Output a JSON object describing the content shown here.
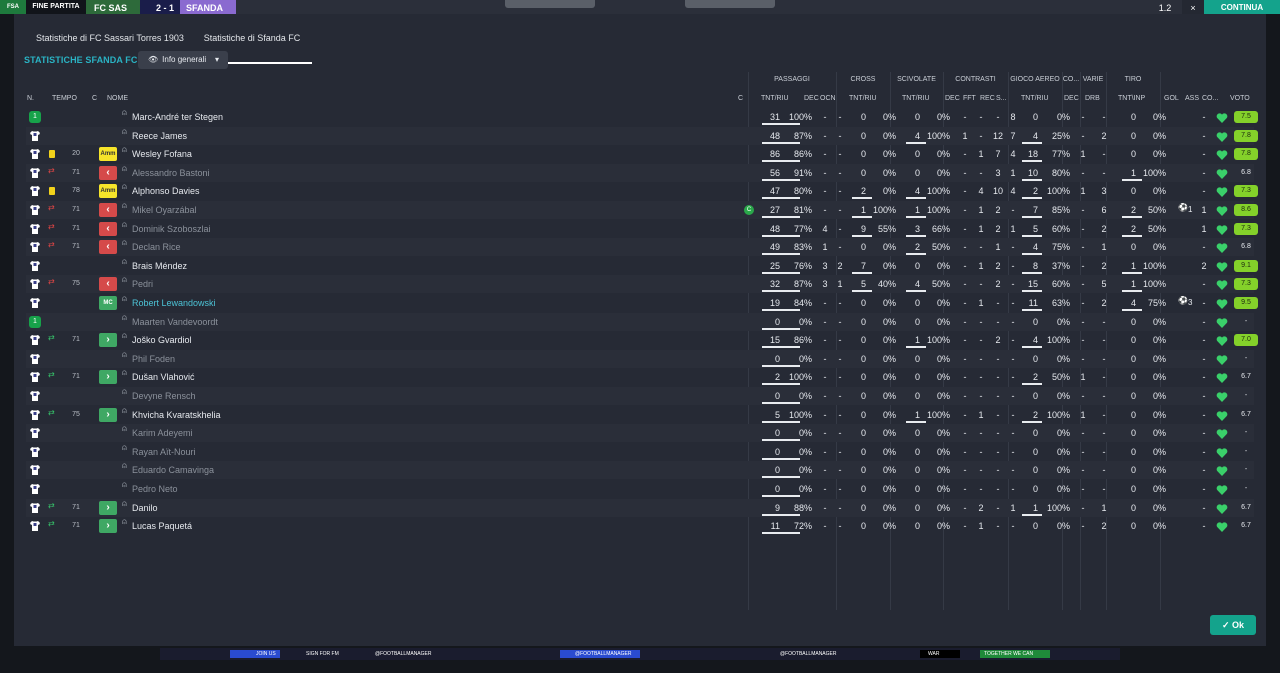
{
  "topbar": {
    "competition_badge": "FSA",
    "status": "FINE PARTITA",
    "home_short": "FC SAS",
    "score": "2 - 1",
    "away_short": "SFANDA",
    "speed": "1.2",
    "close": "×",
    "continue": "CONTINUA"
  },
  "tabs": [
    "Statistiche di FC Sassari Torres 1903",
    "Statistiche di Sfanda FC"
  ],
  "title": "STATISTICHE SFANDA FC",
  "view_dropdown": "Info generali",
  "groups": [
    "PASSAGGI",
    "CROSS",
    "SCIVOLATE",
    "CONTRASTI",
    "GIOCO AEREO",
    "CO...",
    "VARIE",
    "TIRO"
  ],
  "columns": {
    "n": "N.",
    "tempo": "TEMPO",
    "c": "C",
    "nome": "NOME",
    "c2": "C",
    "pass_tnt": "TNT/RIU",
    "pass_dec": "DEC",
    "pass_ocn": "OCN",
    "cross_tnt": "TNT/RIU",
    "sciv_tnt": "TNT/RIU",
    "contr_dec": "DEC",
    "contr_fft": "FFT",
    "contr_rec": "REC",
    "contr_s": "S...",
    "aereo_tnt": "TNT/RIU",
    "co_dec": "DEC",
    "varie_drb": "DRB",
    "tiro_tnt": "TNT\\INP",
    "gol": "GOL",
    "ass": "ASS",
    "co": "CO...",
    "voto": "VOTO"
  },
  "players": [
    {
      "shirt": "gk",
      "min": "",
      "status": "",
      "pos": "",
      "name": "Marc-André ter Stegen",
      "dim": false,
      "pass": [
        "31",
        "100%"
      ],
      "dec": "-",
      "ocn": "-",
      "cross": [
        "0",
        "0%"
      ],
      "sciv": [
        "0",
        "0%"
      ],
      "cdec": "-",
      "fft": "-",
      "rec": "-",
      "s": "8",
      "air": [
        "0",
        "0%"
      ],
      "codec": "-",
      "drb": "-",
      "tiro": [
        "0",
        "0%"
      ],
      "gol": "",
      "ass": "-",
      "voto": "7.5",
      "mom": ""
    },
    {
      "shirt": "w",
      "min": "",
      "status": "",
      "pos": "",
      "name": "Reece James",
      "dim": false,
      "pass": [
        "48",
        "87%"
      ],
      "dec": "-",
      "ocn": "-",
      "cross": [
        "0",
        "0%"
      ],
      "sciv": [
        "4",
        "100%"
      ],
      "cdec": "1",
      "fft": "-",
      "rec": "12",
      "s": "7",
      "air": [
        "4",
        "25%"
      ],
      "codec": "-",
      "drb": "2",
      "tiro": [
        "0",
        "0%"
      ],
      "gol": "",
      "ass": "-",
      "voto": "7.8",
      "mom": ""
    },
    {
      "shirt": "w",
      "min": "20",
      "status": "yellow",
      "pos": "Amm",
      "name": "Wesley Fofana",
      "dim": false,
      "pass": [
        "86",
        "86%"
      ],
      "dec": "-",
      "ocn": "-",
      "cross": [
        "0",
        "0%"
      ],
      "sciv": [
        "0",
        "0%"
      ],
      "cdec": "-",
      "fft": "1",
      "rec": "7",
      "s": "4",
      "air": [
        "18",
        "77%"
      ],
      "codec": "1",
      "drb": "-",
      "tiro": [
        "0",
        "0%"
      ],
      "gol": "",
      "ass": "-",
      "voto": "7.8",
      "mom": ""
    },
    {
      "shirt": "w",
      "min": "71",
      "status": "subout",
      "pos": "out",
      "name": "Alessandro Bastoni",
      "dim": true,
      "pass": [
        "56",
        "91%"
      ],
      "dec": "-",
      "ocn": "-",
      "cross": [
        "0",
        "0%"
      ],
      "sciv": [
        "0",
        "0%"
      ],
      "cdec": "-",
      "fft": "-",
      "rec": "3",
      "s": "1",
      "air": [
        "10",
        "80%"
      ],
      "codec": "-",
      "drb": "-",
      "tiro": [
        "1",
        "100%"
      ],
      "gol": "",
      "ass": "-",
      "voto": "6.8",
      "mom": ""
    },
    {
      "shirt": "w",
      "min": "78",
      "status": "yellow",
      "pos": "Amm",
      "name": "Alphonso Davies",
      "dim": false,
      "pass": [
        "47",
        "80%"
      ],
      "dec": "-",
      "ocn": "-",
      "cross": [
        "2",
        "0%"
      ],
      "sciv": [
        "4",
        "100%"
      ],
      "cdec": "-",
      "fft": "4",
      "rec": "10",
      "s": "4",
      "air": [
        "2",
        "100%"
      ],
      "codec": "1",
      "drb": "3",
      "tiro": [
        "0",
        "0%"
      ],
      "gol": "",
      "ass": "-",
      "voto": "7.3",
      "mom": ""
    },
    {
      "shirt": "w",
      "min": "71",
      "status": "subout",
      "pos": "out",
      "name": "Mikel Oyarzábal",
      "dim": true,
      "pass": [
        "27",
        "81%"
      ],
      "dec": "-",
      "ocn": "-",
      "cross": [
        "1",
        "100%"
      ],
      "sciv": [
        "1",
        "100%"
      ],
      "cdec": "-",
      "fft": "1",
      "rec": "2",
      "s": "-",
      "air": [
        "7",
        "85%"
      ],
      "codec": "-",
      "drb": "6",
      "tiro": [
        "2",
        "50%"
      ],
      "gol": "1",
      "ass": "1",
      "voto": "8.6",
      "mom": "C"
    },
    {
      "shirt": "w",
      "min": "71",
      "status": "subout",
      "pos": "out",
      "name": "Dominik Szoboszlai",
      "dim": true,
      "pass": [
        "48",
        "77%"
      ],
      "dec": "4",
      "ocn": "-",
      "cross": [
        "9",
        "55%"
      ],
      "sciv": [
        "3",
        "66%"
      ],
      "cdec": "-",
      "fft": "1",
      "rec": "2",
      "s": "1",
      "air": [
        "5",
        "60%"
      ],
      "codec": "-",
      "drb": "2",
      "tiro": [
        "2",
        "50%"
      ],
      "gol": "",
      "ass": "1",
      "voto": "7.3",
      "mom": ""
    },
    {
      "shirt": "w",
      "min": "71",
      "status": "subout",
      "pos": "out",
      "name": "Declan Rice",
      "dim": true,
      "pass": [
        "49",
        "83%"
      ],
      "dec": "1",
      "ocn": "-",
      "cross": [
        "0",
        "0%"
      ],
      "sciv": [
        "2",
        "50%"
      ],
      "cdec": "-",
      "fft": "-",
      "rec": "1",
      "s": "-",
      "air": [
        "4",
        "75%"
      ],
      "codec": "-",
      "drb": "1",
      "tiro": [
        "0",
        "0%"
      ],
      "gol": "",
      "ass": "-",
      "voto": "6.8",
      "mom": ""
    },
    {
      "shirt": "w",
      "min": "",
      "status": "",
      "pos": "",
      "name": "Brais Méndez",
      "dim": false,
      "pass": [
        "25",
        "76%"
      ],
      "dec": "3",
      "ocn": "2",
      "cross": [
        "7",
        "0%"
      ],
      "sciv": [
        "0",
        "0%"
      ],
      "cdec": "-",
      "fft": "1",
      "rec": "2",
      "s": "-",
      "air": [
        "8",
        "37%"
      ],
      "codec": "-",
      "drb": "2",
      "tiro": [
        "1",
        "100%"
      ],
      "gol": "",
      "ass": "2",
      "voto": "9.1",
      "mom": ""
    },
    {
      "shirt": "w",
      "min": "75",
      "status": "subout",
      "pos": "out",
      "name": "Pedri",
      "dim": true,
      "pass": [
        "32",
        "87%"
      ],
      "dec": "3",
      "ocn": "1",
      "cross": [
        "5",
        "40%"
      ],
      "sciv": [
        "4",
        "50%"
      ],
      "cdec": "-",
      "fft": "-",
      "rec": "2",
      "s": "-",
      "air": [
        "15",
        "60%"
      ],
      "codec": "-",
      "drb": "5",
      "tiro": [
        "1",
        "100%"
      ],
      "gol": "",
      "ass": "-",
      "voto": "7.3",
      "mom": ""
    },
    {
      "shirt": "w",
      "min": "",
      "status": "",
      "pos": "MC",
      "name": "Robert Lewandowski",
      "dim": false,
      "hl": true,
      "pass": [
        "19",
        "84%"
      ],
      "dec": "-",
      "ocn": "-",
      "cross": [
        "0",
        "0%"
      ],
      "sciv": [
        "0",
        "0%"
      ],
      "cdec": "-",
      "fft": "1",
      "rec": "-",
      "s": "-",
      "air": [
        "11",
        "63%"
      ],
      "codec": "-",
      "drb": "2",
      "tiro": [
        "4",
        "75%"
      ],
      "gol": "3",
      "ass": "-",
      "voto": "9.5",
      "mom": ""
    },
    {
      "shirt": "gk",
      "min": "",
      "status": "",
      "pos": "",
      "name": "Maarten Vandevoordt",
      "dim": true,
      "pass": [
        "0",
        "0%"
      ],
      "dec": "-",
      "ocn": "-",
      "cross": [
        "0",
        "0%"
      ],
      "sciv": [
        "0",
        "0%"
      ],
      "cdec": "-",
      "fft": "-",
      "rec": "-",
      "s": "-",
      "air": [
        "0",
        "0%"
      ],
      "codec": "-",
      "drb": "-",
      "tiro": [
        "0",
        "0%"
      ],
      "gol": "",
      "ass": "-",
      "voto": "-",
      "mom": ""
    },
    {
      "shirt": "w",
      "min": "71",
      "status": "subin",
      "pos": "in",
      "name": "Joško Gvardiol",
      "dim": false,
      "pass": [
        "15",
        "86%"
      ],
      "dec": "-",
      "ocn": "-",
      "cross": [
        "0",
        "0%"
      ],
      "sciv": [
        "1",
        "100%"
      ],
      "cdec": "-",
      "fft": "-",
      "rec": "2",
      "s": "-",
      "air": [
        "4",
        "100%"
      ],
      "codec": "-",
      "drb": "-",
      "tiro": [
        "0",
        "0%"
      ],
      "gol": "",
      "ass": "-",
      "voto": "7.0",
      "mom": ""
    },
    {
      "shirt": "w",
      "min": "",
      "status": "",
      "pos": "",
      "name": "Phil Foden",
      "dim": true,
      "pass": [
        "0",
        "0%"
      ],
      "dec": "-",
      "ocn": "-",
      "cross": [
        "0",
        "0%"
      ],
      "sciv": [
        "0",
        "0%"
      ],
      "cdec": "-",
      "fft": "-",
      "rec": "-",
      "s": "-",
      "air": [
        "0",
        "0%"
      ],
      "codec": "-",
      "drb": "-",
      "tiro": [
        "0",
        "0%"
      ],
      "gol": "",
      "ass": "-",
      "voto": "-",
      "mom": ""
    },
    {
      "shirt": "w",
      "min": "71",
      "status": "subin",
      "pos": "in",
      "name": "Dušan Vlahović",
      "dim": false,
      "pass": [
        "2",
        "100%"
      ],
      "dec": "-",
      "ocn": "-",
      "cross": [
        "0",
        "0%"
      ],
      "sciv": [
        "0",
        "0%"
      ],
      "cdec": "-",
      "fft": "-",
      "rec": "-",
      "s": "-",
      "air": [
        "2",
        "50%"
      ],
      "codec": "1",
      "drb": "-",
      "tiro": [
        "0",
        "0%"
      ],
      "gol": "",
      "ass": "-",
      "voto": "6.7",
      "mom": ""
    },
    {
      "shirt": "w",
      "min": "",
      "status": "",
      "pos": "",
      "name": "Devyne Rensch",
      "dim": true,
      "pass": [
        "0",
        "0%"
      ],
      "dec": "-",
      "ocn": "-",
      "cross": [
        "0",
        "0%"
      ],
      "sciv": [
        "0",
        "0%"
      ],
      "cdec": "-",
      "fft": "-",
      "rec": "-",
      "s": "-",
      "air": [
        "0",
        "0%"
      ],
      "codec": "-",
      "drb": "-",
      "tiro": [
        "0",
        "0%"
      ],
      "gol": "",
      "ass": "-",
      "voto": "-",
      "mom": ""
    },
    {
      "shirt": "w",
      "min": "75",
      "status": "subin",
      "pos": "in",
      "name": "Khvicha Kvaratskhelia",
      "dim": false,
      "pass": [
        "5",
        "100%"
      ],
      "dec": "-",
      "ocn": "-",
      "cross": [
        "0",
        "0%"
      ],
      "sciv": [
        "1",
        "100%"
      ],
      "cdec": "-",
      "fft": "1",
      "rec": "-",
      "s": "-",
      "air": [
        "2",
        "100%"
      ],
      "codec": "1",
      "drb": "-",
      "tiro": [
        "0",
        "0%"
      ],
      "gol": "",
      "ass": "-",
      "voto": "6.7",
      "mom": ""
    },
    {
      "shirt": "w",
      "min": "",
      "status": "",
      "pos": "",
      "name": "Karim Adeyemi",
      "dim": true,
      "pass": [
        "0",
        "0%"
      ],
      "dec": "-",
      "ocn": "-",
      "cross": [
        "0",
        "0%"
      ],
      "sciv": [
        "0",
        "0%"
      ],
      "cdec": "-",
      "fft": "-",
      "rec": "-",
      "s": "-",
      "air": [
        "0",
        "0%"
      ],
      "codec": "-",
      "drb": "-",
      "tiro": [
        "0",
        "0%"
      ],
      "gol": "",
      "ass": "-",
      "voto": "-",
      "mom": ""
    },
    {
      "shirt": "w",
      "min": "",
      "status": "",
      "pos": "",
      "name": "Rayan Aït-Nouri",
      "dim": true,
      "pass": [
        "0",
        "0%"
      ],
      "dec": "-",
      "ocn": "-",
      "cross": [
        "0",
        "0%"
      ],
      "sciv": [
        "0",
        "0%"
      ],
      "cdec": "-",
      "fft": "-",
      "rec": "-",
      "s": "-",
      "air": [
        "0",
        "0%"
      ],
      "codec": "-",
      "drb": "-",
      "tiro": [
        "0",
        "0%"
      ],
      "gol": "",
      "ass": "-",
      "voto": "-",
      "mom": ""
    },
    {
      "shirt": "w",
      "min": "",
      "status": "",
      "pos": "",
      "name": "Eduardo Camavinga",
      "dim": true,
      "pass": [
        "0",
        "0%"
      ],
      "dec": "-",
      "ocn": "-",
      "cross": [
        "0",
        "0%"
      ],
      "sciv": [
        "0",
        "0%"
      ],
      "cdec": "-",
      "fft": "-",
      "rec": "-",
      "s": "-",
      "air": [
        "0",
        "0%"
      ],
      "codec": "-",
      "drb": "-",
      "tiro": [
        "0",
        "0%"
      ],
      "gol": "",
      "ass": "-",
      "voto": "-",
      "mom": ""
    },
    {
      "shirt": "w",
      "min": "",
      "status": "",
      "pos": "",
      "name": "Pedro Neto",
      "dim": true,
      "pass": [
        "0",
        "0%"
      ],
      "dec": "-",
      "ocn": "-",
      "cross": [
        "0",
        "0%"
      ],
      "sciv": [
        "0",
        "0%"
      ],
      "cdec": "-",
      "fft": "-",
      "rec": "-",
      "s": "-",
      "air": [
        "0",
        "0%"
      ],
      "codec": "-",
      "drb": "-",
      "tiro": [
        "0",
        "0%"
      ],
      "gol": "",
      "ass": "-",
      "voto": "-",
      "mom": ""
    },
    {
      "shirt": "w",
      "min": "71",
      "status": "subin",
      "pos": "in",
      "name": "Danilo",
      "dim": false,
      "pass": [
        "9",
        "88%"
      ],
      "dec": "-",
      "ocn": "-",
      "cross": [
        "0",
        "0%"
      ],
      "sciv": [
        "0",
        "0%"
      ],
      "cdec": "-",
      "fft": "2",
      "rec": "-",
      "s": "1",
      "air": [
        "1",
        "100%"
      ],
      "codec": "-",
      "drb": "1",
      "tiro": [
        "0",
        "0%"
      ],
      "gol": "",
      "ass": "-",
      "voto": "6.7",
      "mom": ""
    },
    {
      "shirt": "w",
      "min": "71",
      "status": "subin",
      "pos": "in",
      "name": "Lucas Paquetá",
      "dim": false,
      "pass": [
        "11",
        "72%"
      ],
      "dec": "-",
      "ocn": "-",
      "cross": [
        "0",
        "0%"
      ],
      "sciv": [
        "0",
        "0%"
      ],
      "cdec": "-",
      "fft": "1",
      "rec": "-",
      "s": "-",
      "air": [
        "0",
        "0%"
      ],
      "codec": "-",
      "drb": "2",
      "tiro": [
        "0",
        "0%"
      ],
      "gol": "",
      "ass": "-",
      "voto": "6.7",
      "mom": ""
    }
  ],
  "ok_label": "Ok",
  "bottom_strip": [
    "JOIN US",
    "SIGN FOR FM",
    "@FOOTBALLMANAGER",
    "@FOOTBALLMANAGER",
    "@FOOTBALLMANAGER",
    "WAR",
    "TOGETHER WE CAN"
  ],
  "colors": {
    "accent": "#2ab3c4",
    "ok": "#14a38c",
    "rating_green": "#84d12a",
    "yellow_card": "#f6e42a",
    "sub_out": "#d54a4a",
    "sub_in": "#3fa864"
  }
}
